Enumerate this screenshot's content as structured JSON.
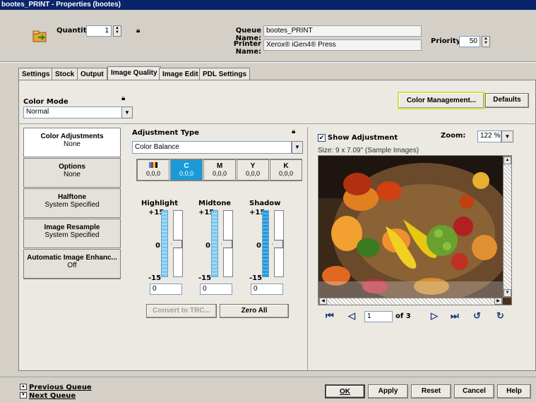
{
  "window": {
    "title": "bootes_PRINT - Properties (bootes)"
  },
  "header": {
    "quantity_label": "Quantity:",
    "quantity_value": "1",
    "queue_name_label": "Queue Name:",
    "queue_name_value": "bootes_PRINT",
    "printer_name_label": "Printer Name:",
    "printer_name_value": "Xerox® iGen4® Press",
    "priority_label": "Priority:",
    "priority_value": "50"
  },
  "tabs": [
    {
      "label": "Settings"
    },
    {
      "label": "Stock"
    },
    {
      "label": "Output"
    },
    {
      "label": "Image Quality"
    },
    {
      "label": "Image Edit"
    },
    {
      "label": "PDL Settings"
    }
  ],
  "color_mode": {
    "label": "Color Mode",
    "value": "Normal"
  },
  "top_buttons": {
    "color_management": "Color Management...",
    "defaults": "Defaults"
  },
  "sidebar": {
    "items": [
      {
        "title": "Color Adjustments",
        "value": "None"
      },
      {
        "title": "Options",
        "value": "None"
      },
      {
        "title": "Halftone",
        "value": "System Specified"
      },
      {
        "title": "Image Resample",
        "value": "System Specified"
      },
      {
        "title": "Automatic Image Enhanc...",
        "value": "Off"
      }
    ]
  },
  "adjustment": {
    "label": "Adjustment Type",
    "value": "Color Balance",
    "channels": [
      {
        "name": "",
        "value": "0,0,0"
      },
      {
        "name": "C",
        "value": "0,0,0"
      },
      {
        "name": "M",
        "value": "0,0,0"
      },
      {
        "name": "Y",
        "value": "0,0,0"
      },
      {
        "name": "K",
        "value": "0,0,0"
      }
    ],
    "sliders": [
      {
        "title": "Highlight",
        "top": "+15",
        "mid": "0",
        "bottom": "-15",
        "value": "0"
      },
      {
        "title": "Midtone",
        "top": "+15",
        "mid": "0",
        "bottom": "-15",
        "value": "0"
      },
      {
        "title": "Shadow",
        "top": "+15",
        "mid": "0",
        "bottom": "-15",
        "value": "0"
      }
    ],
    "convert_button": "Convert to TRC...",
    "zero_all_button": "Zero All"
  },
  "preview": {
    "show_label": "Show Adjustment",
    "zoom_label": "Zoom:",
    "zoom_value": "122 %",
    "size_text": "Size: 9 x 7.09\"  (Sample Images)",
    "page_value": "1",
    "page_of": "of 3"
  },
  "footer": {
    "previous_queue": "Previous Queue",
    "next_queue": "Next Queue",
    "ok": "OK",
    "apply": "Apply",
    "reset": "Reset",
    "cancel": "Cancel",
    "help": "Help"
  },
  "colors": {
    "title_bar": "#0a246a",
    "accent_blue": "#1a9bd7",
    "highlight_border": "#c8e64a"
  }
}
